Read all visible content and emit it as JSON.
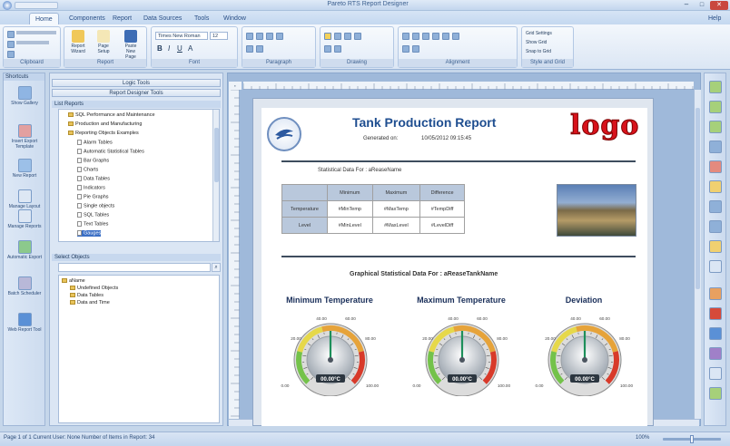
{
  "title_bar": {
    "title": "Pareto RTS Report Designer",
    "help_label": "Help"
  },
  "tabs": [
    "Home",
    "Components",
    "Report",
    "Data Sources",
    "Tools",
    "Window"
  ],
  "ribbon": {
    "groups": [
      "Clipboard",
      "Report",
      "Font",
      "Paragraph",
      "Drawing",
      "Alignment",
      "Style and Grid"
    ],
    "buttons": [
      "Report Wizard",
      "Page Setup",
      "Paste New Page"
    ],
    "font_name": "Times New Roman",
    "font_size": "12",
    "style_buttons": [
      "Grid Settings",
      "Show Grid",
      "Snap to Grid"
    ]
  },
  "left_bar": {
    "header": "Shortcuts",
    "items": [
      "Show Gallery",
      "Insert Export Template",
      "New Report",
      "Manage Layout",
      "Manage Reports",
      "Automatic Export",
      "Batch Scheduler",
      "Web Report Tool"
    ]
  },
  "panel": {
    "buttons": [
      "Logic Tools",
      "Report Designer Tools"
    ],
    "tree1_header": "List Reports",
    "tree1": [
      {
        "label": "SQL Performance and Maintenance",
        "type": "folder",
        "indent": 1
      },
      {
        "label": "Production and Manufacturing",
        "type": "folder",
        "indent": 1
      },
      {
        "label": "Reporting Objects Examples",
        "type": "folder",
        "indent": 1
      },
      {
        "label": "Alarm Tables",
        "type": "page",
        "indent": 2
      },
      {
        "label": "Automatic Statistical Tables",
        "type": "page",
        "indent": 2
      },
      {
        "label": "Bar Graphs",
        "type": "page",
        "indent": 2
      },
      {
        "label": "Charts",
        "type": "page",
        "indent": 2
      },
      {
        "label": "Data Tables",
        "type": "page",
        "indent": 2
      },
      {
        "label": "Indicators",
        "type": "page",
        "indent": 2
      },
      {
        "label": "Pie Graphs",
        "type": "page",
        "indent": 2
      },
      {
        "label": "Single objects",
        "type": "page",
        "indent": 2
      },
      {
        "label": "SQL Tables",
        "type": "page",
        "indent": 2
      },
      {
        "label": "Text Tables",
        "type": "page",
        "indent": 2
      },
      {
        "label": "Gauges",
        "type": "page",
        "indent": 2,
        "selected": true
      }
    ],
    "tree2_header": "Select Objects",
    "search_placeholder": "",
    "tree2": [
      {
        "label": "aName",
        "indent": 0
      },
      {
        "label": "Undefined Objects",
        "indent": 1
      },
      {
        "label": "Data Tables",
        "indent": 1
      },
      {
        "label": "Data and Time",
        "indent": 1
      }
    ]
  },
  "report": {
    "title": "Tank Production Report",
    "generated_label": "Generated on:",
    "generated_value": "10/05/2012 09:15:45",
    "logo_text": "logo",
    "stats_heading": "Statistical Data For : aReaseName",
    "table_headers": [
      "",
      "Minimum",
      "Maximum",
      "Difference"
    ],
    "table_rows": [
      [
        "Temperature",
        "#MinTemp",
        "#MaxTemp",
        "#TempDiff"
      ],
      [
        "Level",
        "#MinLevel",
        "#MaxLevel",
        "#LevelDiff"
      ]
    ],
    "graph_heading": "Graphical Statistical Data For : aReaseTankName",
    "gauges": [
      {
        "title": "Minimum Temperature",
        "readout": "00.00°C",
        "scale": [
          "20.00",
          "40.00",
          "60.00",
          "80.00",
          "100.00",
          "0.00"
        ]
      },
      {
        "title": "Maximum Temperature",
        "readout": "00.00°C",
        "scale": [
          "20.00",
          "40.00",
          "60.00",
          "80.00",
          "100.00",
          "0.00"
        ]
      },
      {
        "title": "Deviation",
        "readout": "00.00°C",
        "scale": [
          "20.00",
          "40.00",
          "60.00",
          "80.00",
          "100.00",
          "0.00"
        ]
      }
    ]
  },
  "status": {
    "text": "Page 1 of 1   Current User: None   Number of Items in Report: 34",
    "zoom": "100%"
  },
  "colors": {
    "accent": "#1f5fb0",
    "logo_red": "#d8121b",
    "tree_select": "#3b6fc5"
  }
}
